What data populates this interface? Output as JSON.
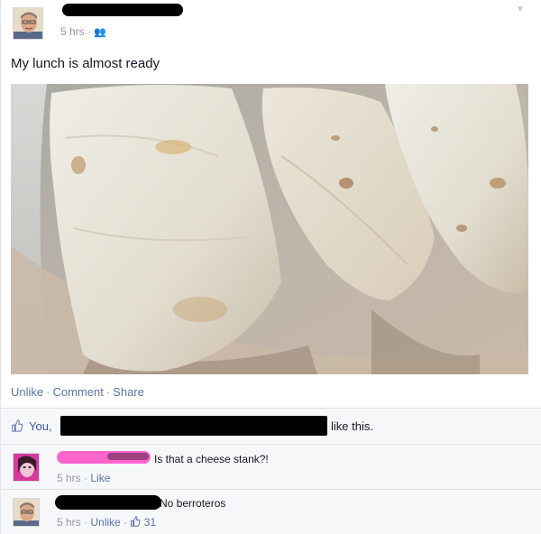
{
  "post": {
    "timestamp": "5 hrs",
    "audience_icon": "friends-icon",
    "text": "My lunch is almost ready"
  },
  "actions": {
    "unlike": "Unlike",
    "comment": "Comment",
    "share": "Share",
    "separator": "·"
  },
  "likes": {
    "you": "You,",
    "suffix": "like this."
  },
  "comments": [
    {
      "text": "Is that a cheese stank?!",
      "time": "5 hrs",
      "like_label": "Like"
    },
    {
      "text": "No berroteros",
      "time": "5 hrs",
      "unlike_label": "Unlike",
      "like_count": "31"
    }
  ],
  "colors": {
    "link": "#5b74a8",
    "meta": "#9197a3",
    "ufi_bg": "#f6f7f9",
    "redaction": "#000000",
    "pink_redaction": "#ff66cc"
  }
}
